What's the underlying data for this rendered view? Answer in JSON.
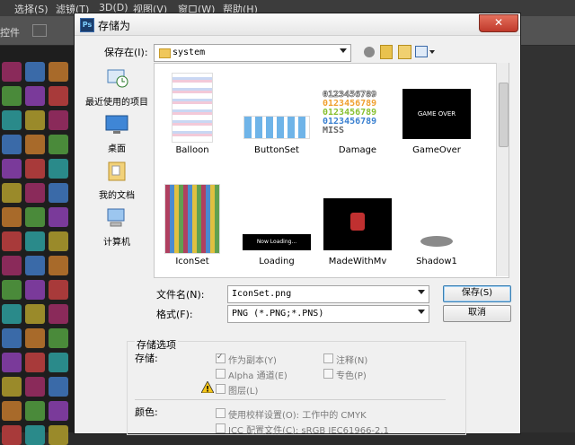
{
  "ps": {
    "menu": [
      "选择(S)",
      "滤镜(T)",
      "3D(D)",
      "视图(V)",
      "窗口(W)",
      "帮助(H)"
    ],
    "options_label": "控件"
  },
  "dialog": {
    "title": "存储为",
    "close_glyph": "✕",
    "save_in_label": "保存在(I):",
    "folder": "system",
    "places": [
      {
        "label": "最近使用的项目",
        "icon": "recent-icon"
      },
      {
        "label": "桌面",
        "icon": "desktop-icon"
      },
      {
        "label": "我的文档",
        "icon": "documents-icon"
      },
      {
        "label": "计算机",
        "icon": "computer-icon"
      }
    ],
    "files": [
      "Balloon",
      "ButtonSet",
      "Damage",
      "GameOver",
      "IconSet",
      "Loading",
      "MadeWithMv",
      "Shadow1"
    ],
    "thumb_text": {
      "gameover": "GAME OVER",
      "loading": "Now Loading...",
      "damage": [
        "0123456789",
        "0123456789",
        "0123456789",
        "0123456789",
        "MISS"
      ]
    },
    "filename_label": "文件名(N):",
    "filename": "IconSet.png",
    "format_label": "格式(F):",
    "format": "PNG (*.PNG;*.PNS)",
    "save_button": "保存(S)",
    "cancel_button": "取消",
    "options_title": "存储选项",
    "storage_label": "存储:",
    "opt_copy": "作为副本(Y)",
    "opt_notes": "注释(N)",
    "opt_alpha": "Alpha 通道(E)",
    "opt_spot": "专色(P)",
    "opt_layers": "图层(L)",
    "color_label": "颜色:",
    "opt_proof": "使用校样设置(O): 工作中的 CMYK",
    "opt_icc": "ICC 配置文件(C): sRGB IEC61966-2.1"
  }
}
